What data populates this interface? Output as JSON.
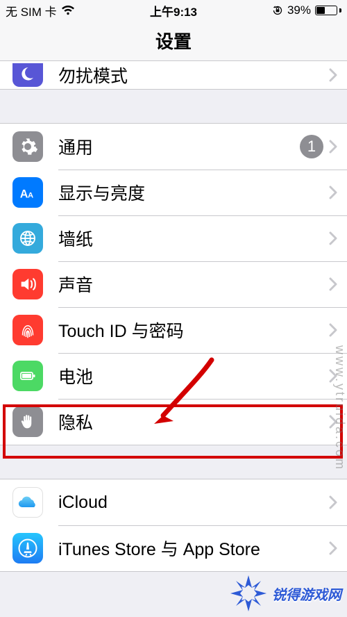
{
  "status": {
    "carrier": "无 SIM 卡",
    "time": "上午9:13",
    "battery_pct": "39%"
  },
  "nav": {
    "title": "设置"
  },
  "group_dnd": {
    "items": [
      {
        "icon": "moon",
        "label": "勿扰模式",
        "color": "#5856d6"
      }
    ]
  },
  "group_main": {
    "items": [
      {
        "icon": "gear",
        "label": "通用",
        "color": "#8e8e93",
        "badge": "1"
      },
      {
        "icon": "text-size",
        "label": "显示与亮度",
        "color": "#007aff"
      },
      {
        "icon": "wallpaper",
        "label": "墙纸",
        "color": "#34aadc"
      },
      {
        "icon": "speaker",
        "label": "声音",
        "color": "#ff3b30"
      },
      {
        "icon": "fingerprint",
        "label": "Touch ID 与密码",
        "color": "#ff3b30"
      },
      {
        "icon": "battery",
        "label": "电池",
        "color": "#4cd964"
      },
      {
        "icon": "hand",
        "label": "隐私",
        "color": "#8e8e93"
      }
    ]
  },
  "group_cloud": {
    "items": [
      {
        "icon": "cloud",
        "label": "iCloud",
        "color": "#ffffff"
      },
      {
        "icon": "appstore",
        "label": "iTunes Store 与 App Store",
        "color": "#1e98f0"
      }
    ]
  },
  "annotation": {
    "highlight_target": "隐私",
    "arrow": true
  },
  "watermark": {
    "text": "www.ytruida.com",
    "brand": "锐得游戏网"
  }
}
